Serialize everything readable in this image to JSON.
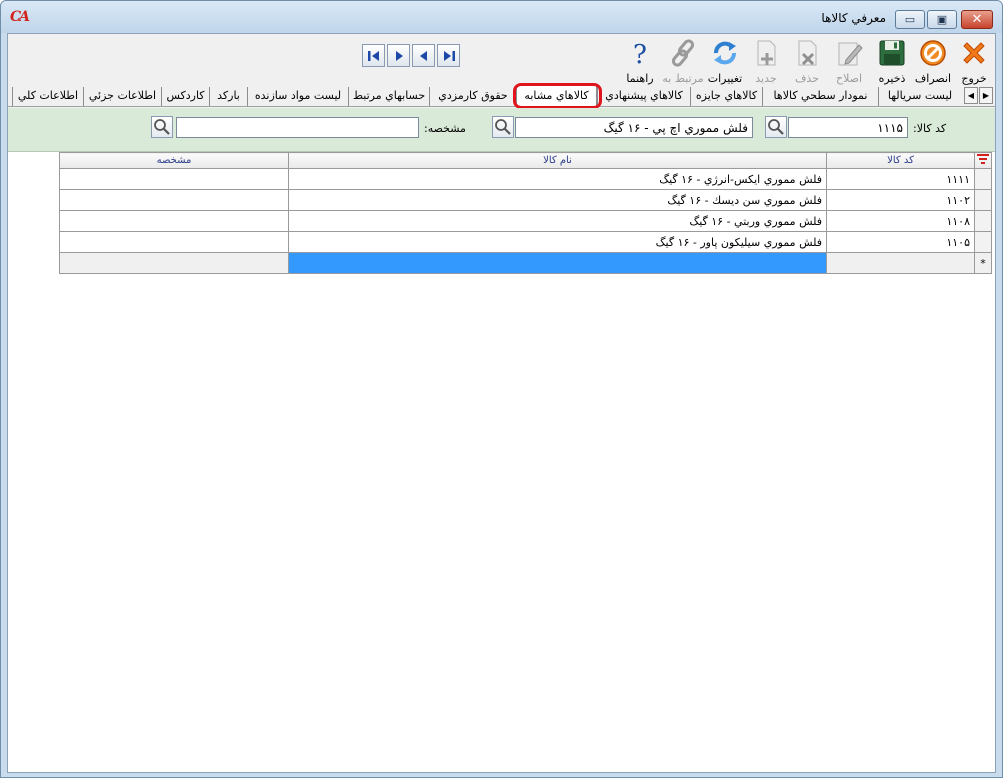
{
  "window": {
    "title": "معرفي كالاها",
    "logo_text": "CA",
    "controls": {
      "minimize": "▭",
      "maximize": "▣",
      "close": "✕"
    }
  },
  "toolbar": {
    "buttons": [
      {
        "id": "exit",
        "label": "خروج",
        "icon": "close-x-icon",
        "enabled": true
      },
      {
        "id": "cancel",
        "label": "انصراف",
        "icon": "cancel-circle-icon",
        "enabled": true
      },
      {
        "id": "save",
        "label": "ذخيره",
        "icon": "floppy-disk-icon",
        "enabled": true
      },
      {
        "id": "edit",
        "label": "اصلاح",
        "icon": "pencil-edit-icon",
        "enabled": false
      },
      {
        "id": "delete",
        "label": "حذف",
        "icon": "delete-doc-icon",
        "enabled": false
      },
      {
        "id": "new",
        "label": "جديد",
        "icon": "new-doc-icon",
        "enabled": false
      },
      {
        "id": "changes",
        "label": "تغييرات",
        "icon": "refresh-icon",
        "enabled": true
      },
      {
        "id": "related",
        "label": "مرتبط به",
        "icon": "link-chain-icon",
        "enabled": false
      },
      {
        "id": "help",
        "label": "راهنما",
        "icon": "question-mark-icon",
        "enabled": true
      }
    ],
    "navigation": [
      "last",
      "next",
      "previous",
      "first"
    ]
  },
  "tabs": [
    {
      "label": "ليست سريالها"
    },
    {
      "label": "نمودار سطحي كالاها"
    },
    {
      "label": "كالاهاي جايزه"
    },
    {
      "label": "كالاهاي پيشنهادي"
    },
    {
      "label": "كالاهاي مشابه",
      "active": true
    },
    {
      "label": "حقوق كارمزدي"
    },
    {
      "label": "حسابهاي مرتبط"
    },
    {
      "label": "ليست مواد سازنده"
    },
    {
      "label": "باركد"
    },
    {
      "label": "كاردكس"
    },
    {
      "label": "اطلاعات جزئي"
    },
    {
      "label": "اطلاعات كلي"
    }
  ],
  "search": {
    "code_label": "كد كالا:",
    "code_value": "۱۱۱۵",
    "name_value": "فلش مموري اچ پي - ۱۶ گيگ",
    "spec_label": "مشخصه:",
    "spec_value": ""
  },
  "grid": {
    "columns": {
      "code": "كد كالا",
      "name": "نام كالا",
      "spec": "مشخصه"
    },
    "rows": [
      {
        "code": "۱۱۱۱",
        "name": "فلش مموري ايكس-انرژي - ۱۶ گيگ",
        "spec": ""
      },
      {
        "code": "۱۱۰۲",
        "name": "فلش مموري سن ديسك - ۱۶ گيگ",
        "spec": ""
      },
      {
        "code": "۱۱۰۸",
        "name": "فلش مموري وربتي - ۱۶ گيگ",
        "spec": ""
      },
      {
        "code": "۱۱۰۵",
        "name": "فلش مموري سيليكون پاور - ۱۶ گيگ",
        "spec": ""
      }
    ],
    "new_row_marker": "*"
  },
  "colors": {
    "accent_red": "#e0141c",
    "selection_blue": "#3399ff",
    "search_panel_bg": "#d9ead9",
    "header_text": "#2b3b88"
  }
}
